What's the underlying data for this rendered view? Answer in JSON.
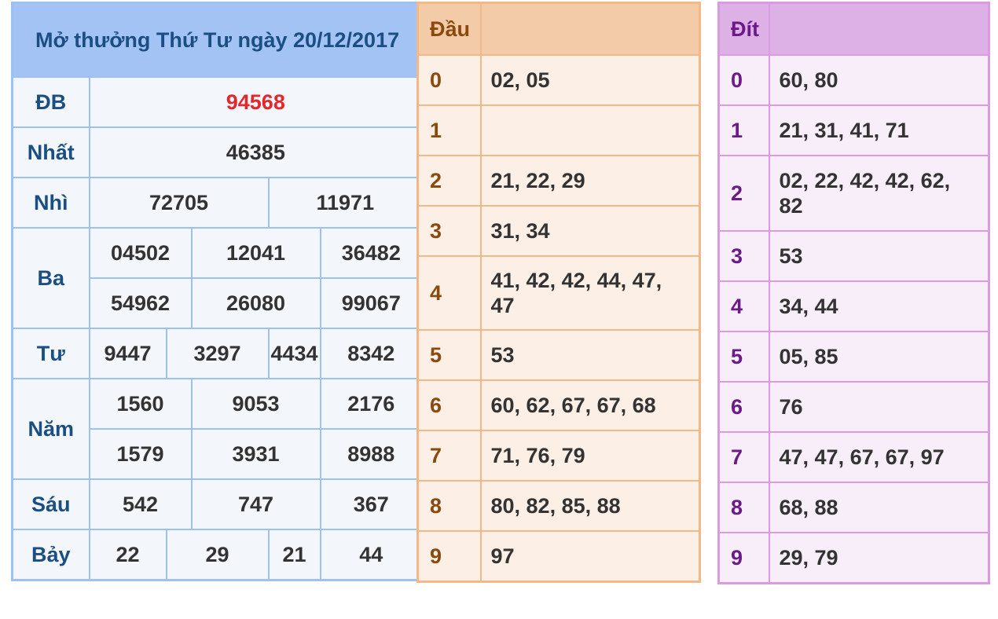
{
  "results": {
    "title": "Mở thưởng Thứ Tư ngày 20/12/2017",
    "prizes": {
      "db": {
        "label": "ĐB",
        "values": [
          "94568"
        ]
      },
      "nhat": {
        "label": "Nhất",
        "values": [
          "46385"
        ]
      },
      "nhi": {
        "label": "Nhì",
        "values": [
          "72705",
          "11971"
        ]
      },
      "ba": {
        "label": "Ba",
        "values": [
          "04502",
          "12041",
          "36482",
          "54962",
          "26080",
          "99067"
        ]
      },
      "tu": {
        "label": "Tư",
        "values": [
          "9447",
          "3297",
          "4434",
          "8342"
        ]
      },
      "nam": {
        "label": "Năm",
        "values": [
          "1560",
          "9053",
          "2176",
          "1579",
          "3931",
          "8988"
        ]
      },
      "sau": {
        "label": "Sáu",
        "values": [
          "542",
          "747",
          "367"
        ]
      },
      "bay": {
        "label": "Bảy",
        "values": [
          "22",
          "29",
          "21",
          "44"
        ]
      }
    },
    "colors": {
      "special_number": "#e5262b",
      "label": "#1b4f83",
      "border": "#9cc1f2"
    }
  },
  "dau": {
    "header": "Đầu",
    "rows": [
      {
        "digit": "0",
        "values": "02, 05"
      },
      {
        "digit": "1",
        "values": ""
      },
      {
        "digit": "2",
        "values": "21, 22, 29"
      },
      {
        "digit": "3",
        "values": "31, 34"
      },
      {
        "digit": "4",
        "values": "41, 42, 42, 44, 47, 47"
      },
      {
        "digit": "5",
        "values": "53"
      },
      {
        "digit": "6",
        "values": "60, 62, 67, 67, 68"
      },
      {
        "digit": "7",
        "values": "71, 76, 79"
      },
      {
        "digit": "8",
        "values": "80, 82, 85, 88"
      },
      {
        "digit": "9",
        "values": "97"
      }
    ],
    "colors": {
      "header_bg": "#f3cba8",
      "border": "#f3b887",
      "digit": "#8a4a0e"
    }
  },
  "dit": {
    "header": "Đít",
    "rows": [
      {
        "digit": "0",
        "values": "60, 80"
      },
      {
        "digit": "1",
        "values": "21, 31, 41, 71"
      },
      {
        "digit": "2",
        "values": "02, 22, 42, 42, 62, 82"
      },
      {
        "digit": "3",
        "values": "53"
      },
      {
        "digit": "4",
        "values": "34, 44"
      },
      {
        "digit": "5",
        "values": "05, 85"
      },
      {
        "digit": "6",
        "values": "76"
      },
      {
        "digit": "7",
        "values": "47, 47, 67, 67, 97"
      },
      {
        "digit": "8",
        "values": "68, 88"
      },
      {
        "digit": "9",
        "values": "29, 79"
      }
    ],
    "colors": {
      "header_bg": "#ddb0e6",
      "border": "#dc9ae3",
      "digit": "#6b1b87"
    }
  }
}
